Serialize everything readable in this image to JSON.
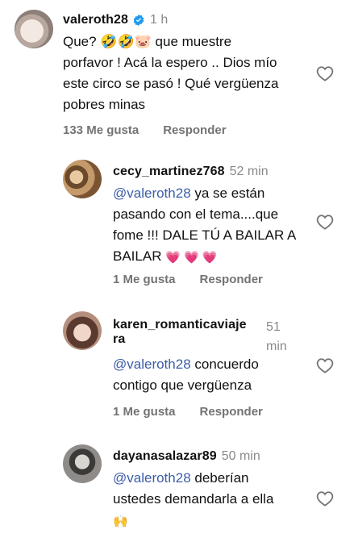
{
  "comments": [
    {
      "username": "valeroth28",
      "verified": true,
      "time": "1 h",
      "text_lines": [
        "Que? 🤣🤣🐷 que muestre",
        "porfavor ! Acá la espero .. Dios mío",
        "este circo se pasó ! Qué vergüenza",
        "pobres minas"
      ],
      "likes": "133 Me gusta",
      "reply": "Responder"
    },
    {
      "username": "cecy_martinez768",
      "time": "52 min",
      "mention": "@valeroth28",
      "text_first": " ya se están",
      "text_lines": [
        "pasando con el tema....que",
        "fome !!! DALE TÚ A BAILAR A",
        "BAILAR"
      ],
      "emojis": "💗 💗 💗",
      "likes": "1 Me gusta",
      "reply": "Responder"
    },
    {
      "username_line1": "karen_romanticaviaje",
      "username_line2": "ra",
      "time_line1": "51",
      "time_line2": "min",
      "mention": "@valeroth28",
      "text_first": " concuerdo",
      "text_line2": "contigo que vergüenza",
      "likes": "1 Me gusta",
      "reply": "Responder"
    },
    {
      "username": "dayanasalazar89",
      "time": "50 min",
      "mention": "@valeroth28",
      "text_first": " deberían",
      "text_line2": "ustedes demandarla a ella",
      "emoji_line": "🙌"
    }
  ],
  "colors": {
    "mention": "#3b5da8",
    "muted": "#737373",
    "verified": "#1d9bf0"
  }
}
